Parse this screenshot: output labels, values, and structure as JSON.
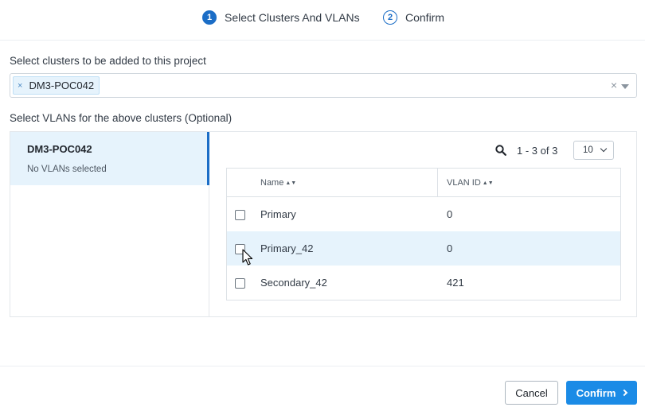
{
  "stepper": {
    "steps": [
      {
        "number": "1",
        "label": "Select Clusters And VLANs",
        "state": "active"
      },
      {
        "number": "2",
        "label": "Confirm",
        "state": "inactive"
      }
    ]
  },
  "clusters_section": {
    "label": "Select clusters to be added to this project",
    "selected": [
      {
        "label": "DM3-POC042",
        "remove_icon": "×"
      }
    ],
    "clear_icon": "×"
  },
  "vlans_section": {
    "label": "Select VLANs for the above clusters (Optional)",
    "clusters": [
      {
        "name": "DM3-POC042",
        "subtitle": "No VLANs selected"
      }
    ],
    "pagination": {
      "range_text": "1 - 3 of 3",
      "per_page": "10"
    },
    "table": {
      "columns": [
        {
          "label": "Name",
          "sort_icon": "▲▼"
        },
        {
          "label": "VLAN ID",
          "sort_icon": "▲▼"
        }
      ],
      "rows": [
        {
          "name": "Primary",
          "vlan_id": "0",
          "checked": false
        },
        {
          "name": "Primary_42",
          "vlan_id": "0",
          "checked": false
        },
        {
          "name": "Secondary_42",
          "vlan_id": "421",
          "checked": false
        }
      ]
    }
  },
  "footer": {
    "cancel_label": "Cancel",
    "confirm_label": "Confirm"
  },
  "colors": {
    "accent": "#1b6dc6",
    "primary_button": "#1b8be6",
    "selected_bg": "#e6f3fc"
  },
  "icons": {
    "search": "search-icon",
    "dropdown": "caret-down-icon",
    "next": "chevron-right-icon"
  }
}
